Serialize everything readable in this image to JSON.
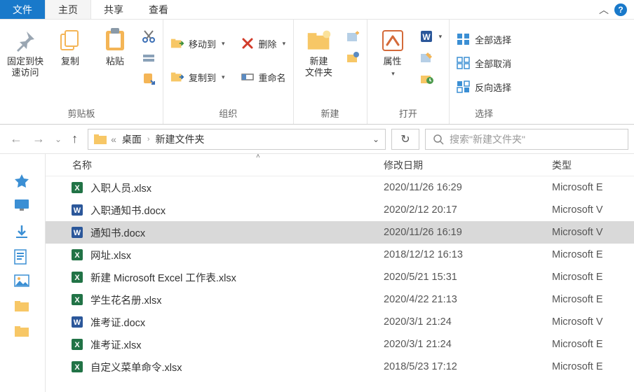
{
  "tabs": {
    "file": "文件",
    "home": "主页",
    "share": "共享",
    "view": "查看"
  },
  "ribbon": {
    "clipboard": {
      "label": "剪贴板",
      "pin": "固定到快\n速访问",
      "copy": "复制",
      "paste": "粘贴"
    },
    "organize": {
      "label": "组织",
      "move_to": "移动到",
      "copy_to": "复制到",
      "delete": "删除",
      "rename": "重命名"
    },
    "new": {
      "label": "新建",
      "new_folder": "新建\n文件夹"
    },
    "open": {
      "label": "打开",
      "properties": "属性"
    },
    "select": {
      "label": "选择",
      "select_all": "全部选择",
      "select_none": "全部取消",
      "invert": "反向选择"
    }
  },
  "nav": {
    "crumb1": "桌面",
    "crumb2": "新建文件夹",
    "search_placeholder": "搜索\"新建文件夹\""
  },
  "columns": {
    "name": "名称",
    "date": "修改日期",
    "type": "类型"
  },
  "files": [
    {
      "name": "入职人员.xlsx",
      "date": "2020/11/26 16:29",
      "type": "Microsoft E",
      "kind": "xlsx"
    },
    {
      "name": "入职通知书.docx",
      "date": "2020/2/12 20:17",
      "type": "Microsoft V",
      "kind": "docx"
    },
    {
      "name": "通知书.docx",
      "date": "2020/11/26 16:19",
      "type": "Microsoft V",
      "kind": "docx",
      "selected": true
    },
    {
      "name": "网址.xlsx",
      "date": "2018/12/12 16:13",
      "type": "Microsoft E",
      "kind": "xlsx"
    },
    {
      "name": "新建 Microsoft Excel 工作表.xlsx",
      "date": "2020/5/21 15:31",
      "type": "Microsoft E",
      "kind": "xlsx"
    },
    {
      "name": "学生花名册.xlsx",
      "date": "2020/4/22 21:13",
      "type": "Microsoft E",
      "kind": "xlsx"
    },
    {
      "name": "准考证.docx",
      "date": "2020/3/1 21:24",
      "type": "Microsoft V",
      "kind": "docx"
    },
    {
      "name": "准考证.xlsx",
      "date": "2020/3/1 21:24",
      "type": "Microsoft E",
      "kind": "xlsx"
    },
    {
      "name": "自定义菜单命令.xlsx",
      "date": "2018/5/23 17:12",
      "type": "Microsoft E",
      "kind": "xlsx"
    }
  ]
}
